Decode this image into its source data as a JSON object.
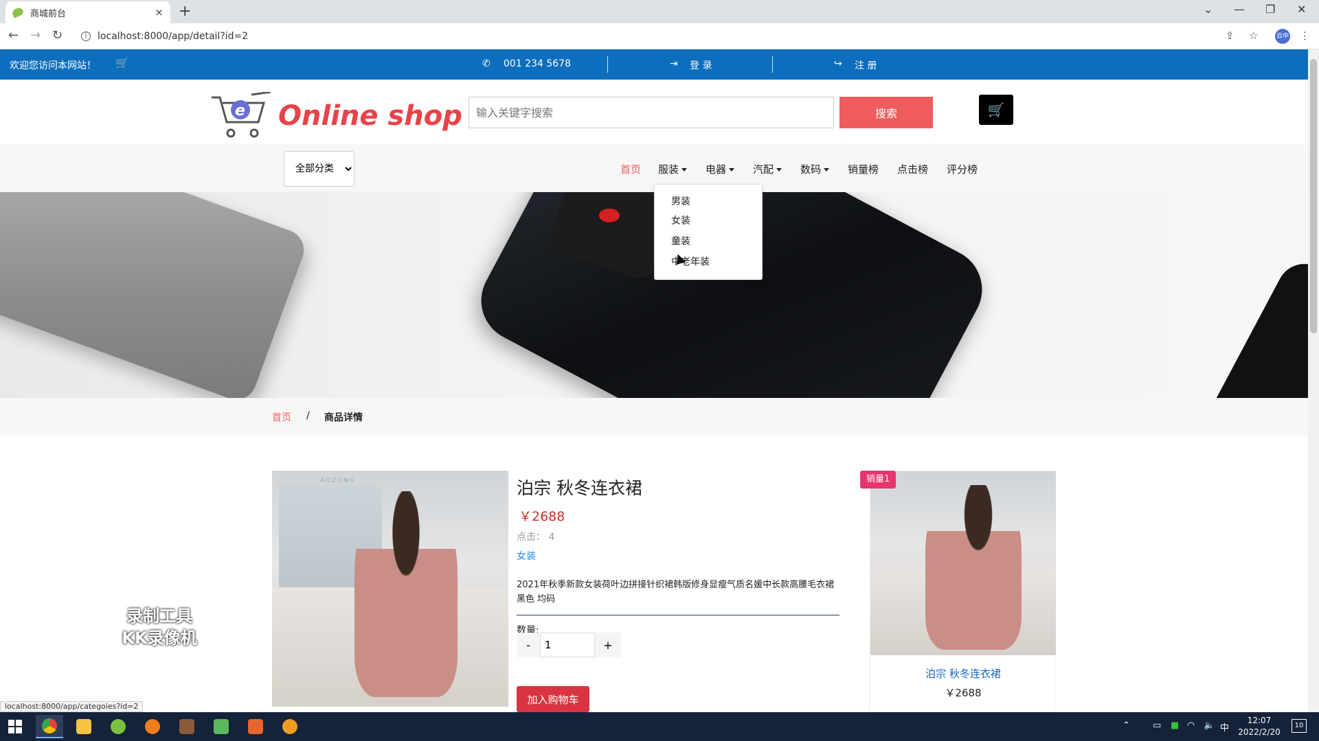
{
  "browser": {
    "tab_title": "商城前台",
    "tab_close": "×",
    "new_tab": "+",
    "url": "localhost:8000/app/detail?id=2",
    "profile_label": "云中",
    "status_url": "localhost:8000/app/categoies?id=2"
  },
  "topbar": {
    "welcome": "欢迎您访问本网站！",
    "phone": "001 234 5678",
    "login": "登 录",
    "register": "注 册"
  },
  "header": {
    "logo_text": "Online shop",
    "search_placeholder": "输入关键字搜索",
    "search_button": "搜索"
  },
  "nav": {
    "category_select": "全部分类",
    "items": [
      {
        "label": "首页",
        "active": true,
        "caret": false
      },
      {
        "label": "服装",
        "active": false,
        "caret": true
      },
      {
        "label": "电器",
        "active": false,
        "caret": true
      },
      {
        "label": "汽配",
        "active": false,
        "caret": true
      },
      {
        "label": "数码",
        "active": false,
        "caret": true
      },
      {
        "label": "销量榜",
        "active": false,
        "caret": false
      },
      {
        "label": "点击榜",
        "active": false,
        "caret": false
      },
      {
        "label": "评分榜",
        "active": false,
        "caret": false
      }
    ],
    "dropdown": [
      "男装",
      "女装",
      "童装",
      "中老年装"
    ]
  },
  "breadcrumb": {
    "home": "首页",
    "separator": "/",
    "current": "商品详情"
  },
  "product": {
    "title": "泊宗 秋冬连衣裙",
    "price": "￥2688",
    "clicks": "点击：  4",
    "category": "女装",
    "description": "2021年秋季新款女装荷叶边拼接针织裙韩版修身显瘦气质名媛中长款高腰毛衣裙 黑色 均码",
    "quantity_label": "数量:",
    "quantity": "1",
    "minus": "-",
    "plus": "+",
    "add_to_cart": "加入购物车",
    "image_watermark": "AOZONG"
  },
  "side_card": {
    "badge": "销量1",
    "name": "泊宗 秋冬连衣裙",
    "price": "￥2688"
  },
  "watermark": {
    "line1": "录制工具",
    "line2": "KK录像机"
  },
  "taskbar": {
    "time": "12:07",
    "date": "2022/2/20",
    "ime": "中",
    "notifications": "10"
  },
  "colors": {
    "topbar": "#0d6ebd",
    "accent_red": "#ef5c5e",
    "price_red": "#c9302c",
    "badge_pink": "#e8346c",
    "link_blue": "#1e88e5"
  }
}
